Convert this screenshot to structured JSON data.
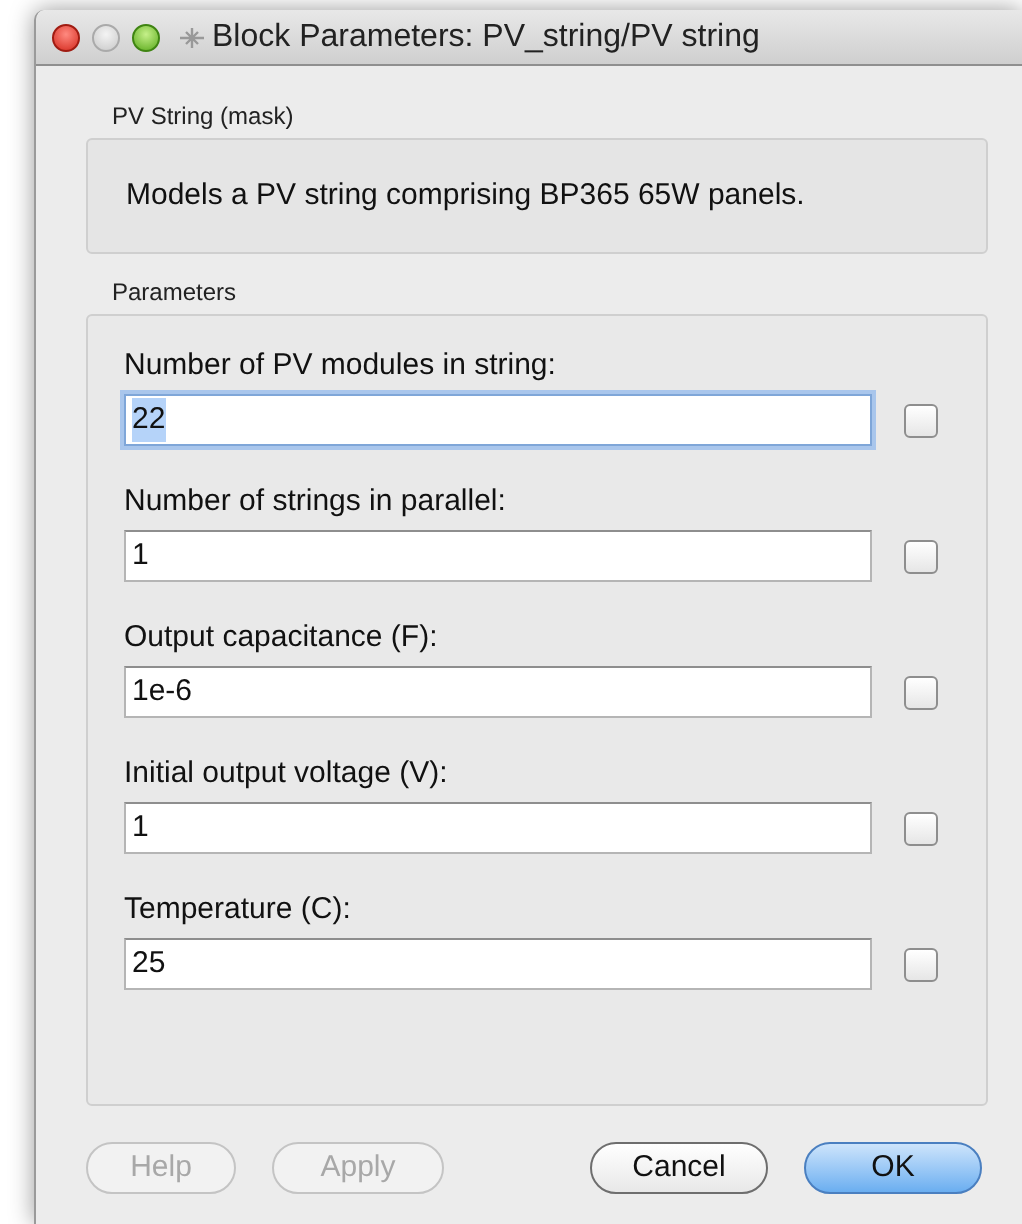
{
  "window": {
    "title": "Block Parameters: PV_string/PV string"
  },
  "mask": {
    "group_label": "PV String (mask)",
    "description": "Models a PV string comprising BP365 65W panels."
  },
  "parameters": {
    "group_label": "Parameters",
    "items": [
      {
        "label": "Number of PV modules in string:",
        "value": "22",
        "focused": true,
        "checked": false
      },
      {
        "label": "Number of strings in parallel:",
        "value": "1",
        "focused": false,
        "checked": false
      },
      {
        "label": "Output capacitance (F):",
        "value": "1e-6",
        "focused": false,
        "checked": false
      },
      {
        "label": "Initial output voltage (V):",
        "value": "1",
        "focused": false,
        "checked": false
      },
      {
        "label": "Temperature (C):",
        "value": "25",
        "focused": false,
        "checked": false
      }
    ]
  },
  "buttons": [
    {
      "label": "Help",
      "disabled": true,
      "default": false
    },
    {
      "label": "Apply",
      "disabled": true,
      "default": false
    },
    {
      "label": "Cancel",
      "disabled": false,
      "default": false
    },
    {
      "label": "OK",
      "disabled": false,
      "default": true
    }
  ]
}
